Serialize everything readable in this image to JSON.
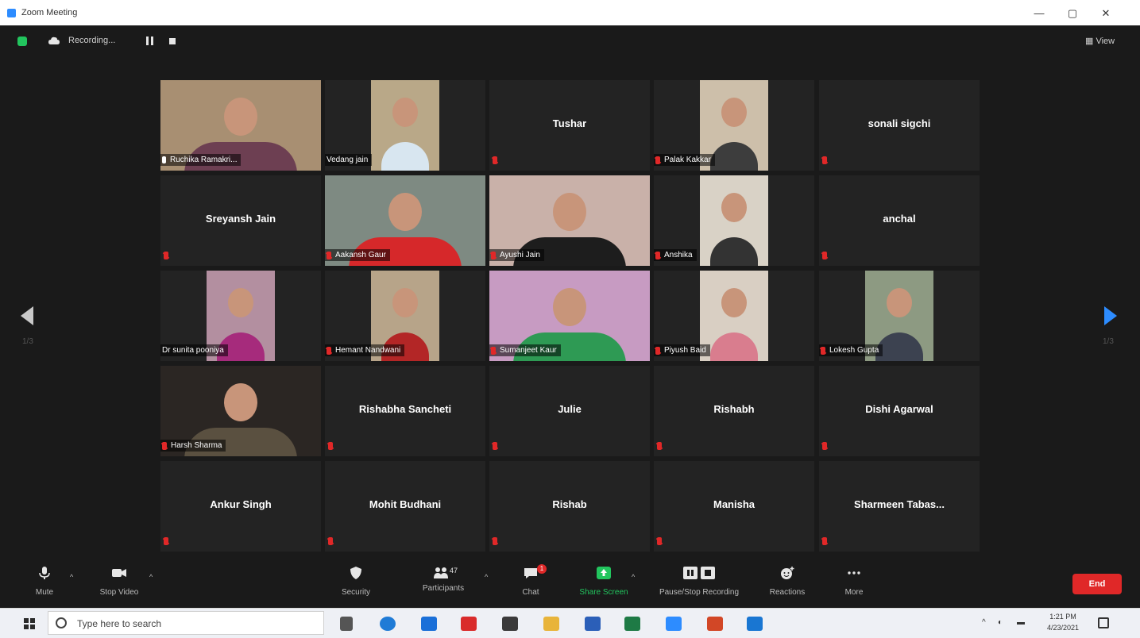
{
  "window": {
    "title": "Zoom Meeting",
    "minimize": "—",
    "restore": "▢",
    "close": "✕"
  },
  "topbar": {
    "recording_text": "Recording...",
    "view_label": "View"
  },
  "pagination": {
    "left_page": "1/3",
    "right_page": "1/3"
  },
  "participants": [
    {
      "name": "Ruchika Ramakri...",
      "video": true,
      "muted": false,
      "active": true
    },
    {
      "name": "Vedang jain",
      "video": true,
      "muted": false
    },
    {
      "name": "Tushar",
      "video": false,
      "muted": true
    },
    {
      "name": "Palak Kakkar",
      "video": true,
      "muted": true
    },
    {
      "name": "sonali sigchi",
      "video": false,
      "muted": true
    },
    {
      "name": "Sreyansh Jain",
      "video": false,
      "muted": true
    },
    {
      "name": "Aakansh Gaur",
      "video": true,
      "muted": true
    },
    {
      "name": "Ayushi Jain",
      "video": true,
      "muted": true
    },
    {
      "name": "Anshika",
      "video": true,
      "muted": true
    },
    {
      "name": "anchal",
      "video": false,
      "muted": true
    },
    {
      "name": "Dr sunita pooniya",
      "video": true,
      "muted": false
    },
    {
      "name": "Hemant Nandwani",
      "video": true,
      "muted": true
    },
    {
      "name": "Sumanjeet Kaur",
      "video": true,
      "muted": true
    },
    {
      "name": "Piyush Baid",
      "video": true,
      "muted": true
    },
    {
      "name": "Lokesh Gupta",
      "video": true,
      "muted": true
    },
    {
      "name": "Harsh Sharma",
      "video": true,
      "muted": true
    },
    {
      "name": "Rishabha Sancheti",
      "video": false,
      "muted": true
    },
    {
      "name": "Julie",
      "video": false,
      "muted": true
    },
    {
      "name": "Rishabh",
      "video": false,
      "muted": true
    },
    {
      "name": "Dishi Agarwal",
      "video": false,
      "muted": true
    },
    {
      "name": "Ankur Singh",
      "video": false,
      "muted": true
    },
    {
      "name": "Mohit Budhani",
      "video": false,
      "muted": true
    },
    {
      "name": "Rishab",
      "video": false,
      "muted": true
    },
    {
      "name": "Manisha",
      "video": false,
      "muted": true
    },
    {
      "name": "Sharmeen Tabas...",
      "video": false,
      "muted": true
    }
  ],
  "toolbar": {
    "mute": "Mute",
    "stop_video": "Stop Video",
    "security": "Security",
    "participants": "Participants",
    "participants_count": "47",
    "chat": "Chat",
    "chat_badge": "1",
    "share_screen": "Share Screen",
    "pause_stop_recording": "Pause/Stop Recording",
    "reactions": "Reactions",
    "more": "More",
    "end": "End"
  },
  "taskbar": {
    "search_placeholder": "Type here to search",
    "time": "1:21 PM",
    "date": "4/23/2021"
  },
  "colors": {
    "active_speaker": "#c4e23a",
    "muted_mic": "#e02828",
    "end_button": "#e02828",
    "share_screen": "#22c55e",
    "zoom_blue": "#2d8cff"
  }
}
